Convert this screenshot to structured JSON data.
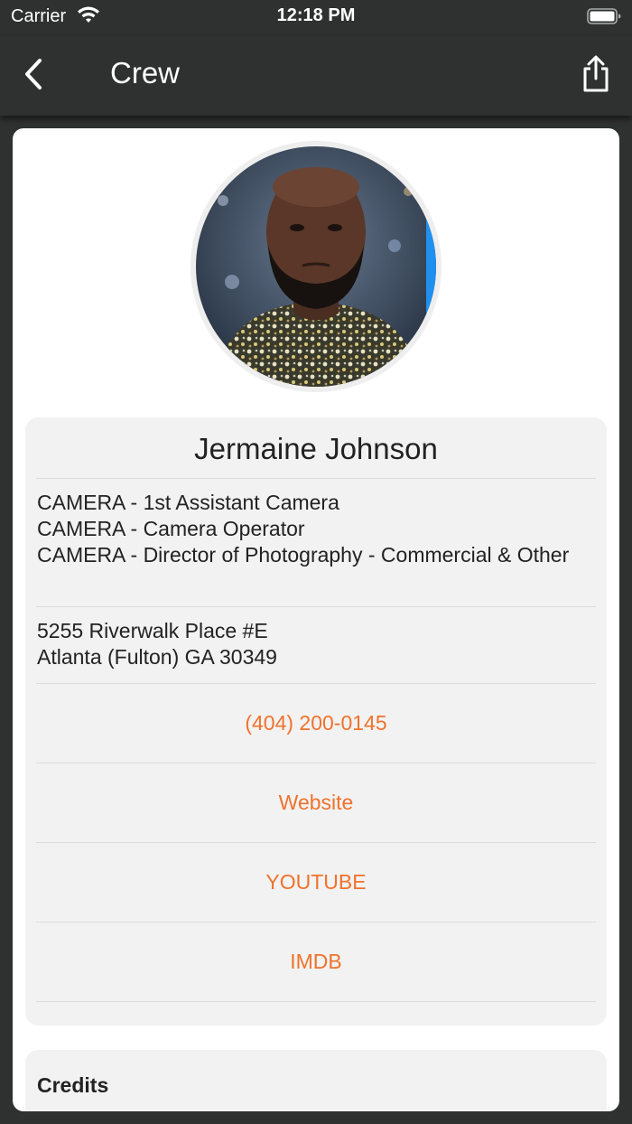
{
  "status_bar": {
    "carrier": "Carrier",
    "time": "12:18 PM",
    "icons": [
      "wifi-icon",
      "battery-icon"
    ]
  },
  "nav": {
    "title": "Crew",
    "back_icon": "chevron-left-icon",
    "share_icon": "share-icon"
  },
  "profile": {
    "name": "Jermaine Johnson",
    "roles": [
      "CAMERA - 1st Assistant Camera",
      "CAMERA - Camera Operator",
      "CAMERA - Director of Photography - Commercial & Other"
    ],
    "address_line1": "5255 Riverwalk Place #E",
    "address_line2": "Atlanta (Fulton) GA 30349",
    "links": {
      "phone": "(404) 200-0145",
      "website": "Website",
      "youtube": "YOUTUBE",
      "imdb": "IMDB"
    }
  },
  "credits": {
    "title": "Credits"
  },
  "colors": {
    "background": "#2f3030",
    "accent": "#f0722c",
    "card": "#ffffff",
    "panel": "#f2f2f2"
  }
}
